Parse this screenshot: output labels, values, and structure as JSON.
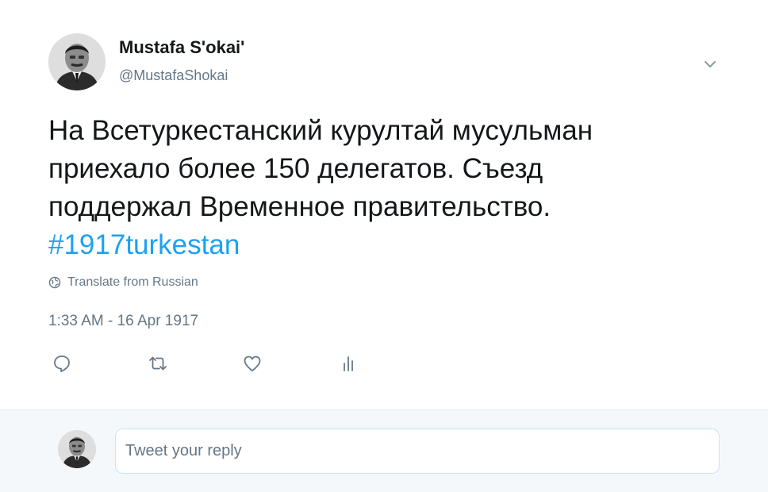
{
  "tweet": {
    "author_name": "Mustafa S'okai'",
    "author_handle": "@MustafaShokai",
    "text_lines": [
      "На Всетуркестанский курултай мусульман",
      "приехало более 150 делегатов. Съезд",
      "поддержал Временное правительство."
    ],
    "hashtag": "#1917turkestan",
    "translate_label": "Translate from Russian",
    "timestamp": "1:33 AM - 16 Apr 1917"
  },
  "actions": [
    {
      "name": "reply-icon"
    },
    {
      "name": "retweet-icon"
    },
    {
      "name": "like-icon"
    },
    {
      "name": "analytics-icon"
    }
  ],
  "reply": {
    "placeholder": "Tweet your reply"
  },
  "colors": {
    "text": "#14171a",
    "secondary": "#657786",
    "accent": "#1da1f2",
    "reply_bg": "#f5f8fa",
    "input_border": "#c9e5f7"
  }
}
